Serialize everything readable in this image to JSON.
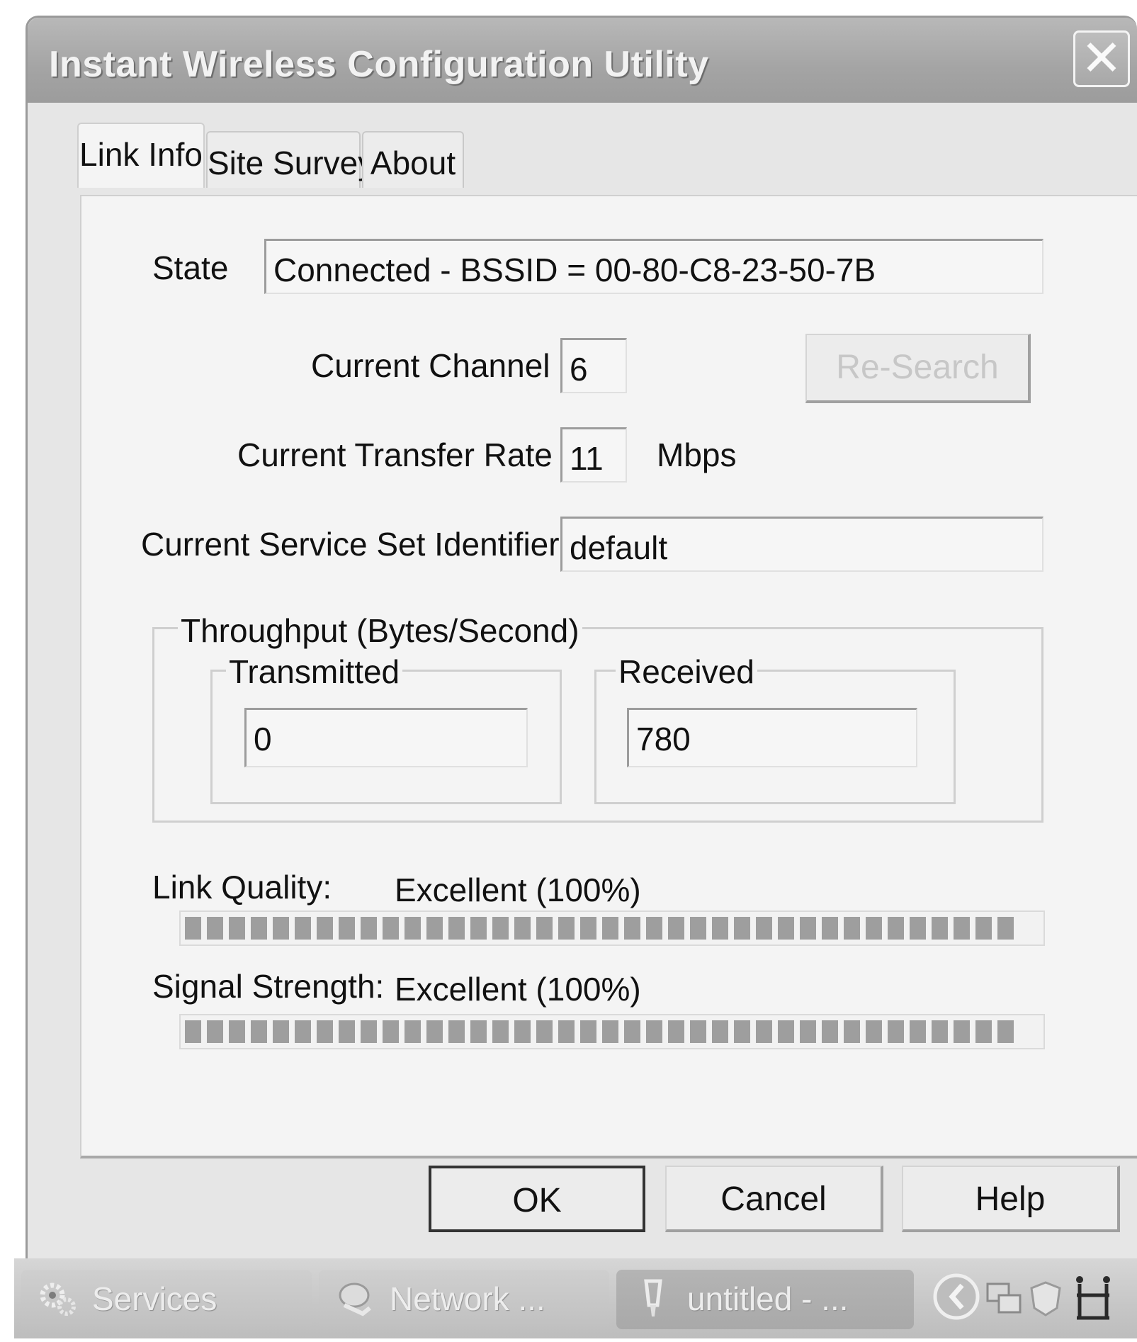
{
  "window": {
    "title": "Instant Wireless Configuration Utility",
    "close_glyph": "✕"
  },
  "tabs": [
    {
      "label": "Link Info",
      "active": true
    },
    {
      "label": "Site Survey",
      "active": false
    },
    {
      "label": "About",
      "active": false
    }
  ],
  "link_info": {
    "state_label": "State",
    "state_value": "Connected - BSSID = 00-80-C8-23-50-7B",
    "channel_label": "Current Channel",
    "channel_value": "6",
    "research_label": "Re-Search",
    "rate_label": "Current Transfer Rate",
    "rate_value": "11",
    "rate_unit": "Mbps",
    "ssid_label": "Current Service Set Identifier",
    "ssid_value": "default",
    "throughput": {
      "group_label": "Throughput (Bytes/Second)",
      "transmitted_label": "Transmitted",
      "transmitted_value": "0",
      "received_label": "Received",
      "received_value": "780"
    },
    "link_quality_label": "Link Quality:",
    "link_quality_value": "Excellent (100%)",
    "link_quality_level": 1.0,
    "signal_strength_label": "Signal Strength:",
    "signal_strength_value": "Excellent (100%)",
    "signal_strength_level": 1.0
  },
  "buttons": {
    "ok": "OK",
    "cancel": "Cancel",
    "help": "Help"
  },
  "taskbar": {
    "tasks": [
      {
        "label": "Services",
        "icon": "gears-icon"
      },
      {
        "label": "Network ...",
        "icon": "network-icon"
      },
      {
        "label": "untitled - ...",
        "icon": "paint-icon"
      }
    ],
    "tray_icons": [
      "chevron-left-icon",
      "network-connection-icon",
      "shield-icon",
      "wireless-utility-icon"
    ]
  }
}
